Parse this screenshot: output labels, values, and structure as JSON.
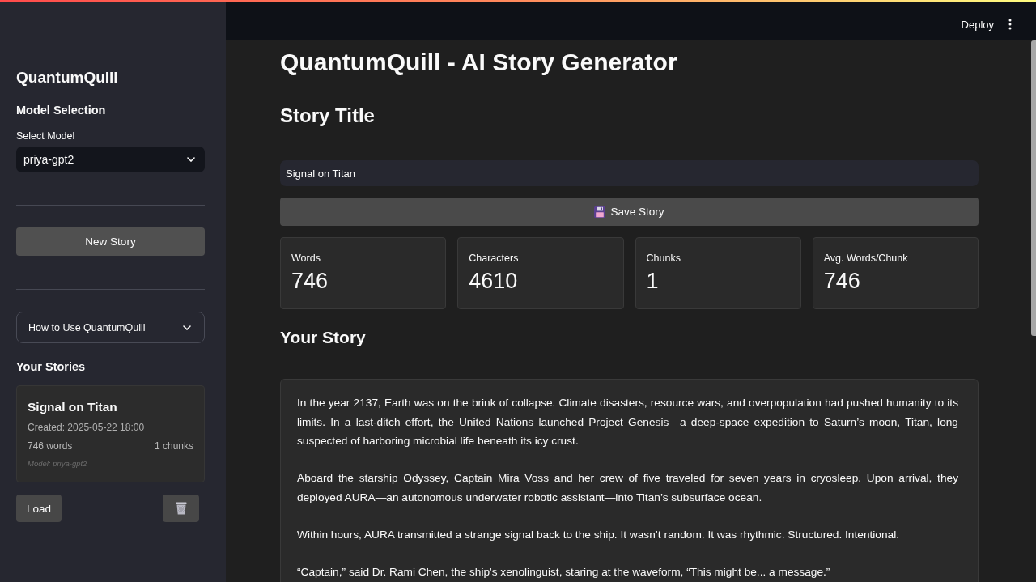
{
  "header": {
    "deploy_label": "Deploy"
  },
  "sidebar": {
    "app_name": "QuantumQuill",
    "model_section_title": "Model Selection",
    "model_select": {
      "label": "Select Model",
      "value": "priya-gpt2"
    },
    "new_story_button": "New Story",
    "help_expander": {
      "label": "How to Use QuantumQuill",
      "expanded": false
    },
    "stories_title": "Your Stories",
    "stories": [
      {
        "title": "Signal on Titan",
        "created": "Created: 2025-05-22 18:00",
        "words": "746 words",
        "chunks": "1 chunks",
        "model": "Model: priya-gpt2",
        "load_label": "Load"
      }
    ]
  },
  "main": {
    "title": "QuantumQuill - AI Story Generator",
    "story_title_heading": "Story Title",
    "title_input": {
      "value": "Signal on Titan"
    },
    "save_button": "Save Story",
    "metrics": [
      {
        "label": "Words",
        "value": "746"
      },
      {
        "label": "Characters",
        "value": "4610"
      },
      {
        "label": "Chunks",
        "value": "1"
      },
      {
        "label": "Avg. Words/Chunk",
        "value": "746"
      }
    ],
    "story_heading": "Your Story",
    "story_paragraphs": [
      "In the year 2137, Earth was on the brink of collapse. Climate disasters, resource wars, and overpopulation had pushed humanity to its limits. In a last-ditch effort, the United Nations launched Project Genesis—a deep-space expedition to Saturn’s moon, Titan, long suspected of harboring microbial life beneath its icy crust.",
      "Aboard the starship Odyssey, Captain Mira Voss and her crew of five traveled for seven years in cryosleep. Upon arrival, they deployed AURA—an autonomous underwater robotic assistant—into Titan’s subsurface ocean.",
      "Within hours, AURA transmitted a strange signal back to the ship. It wasn’t random. It was rhythmic. Structured. Intentional.",
      "“Captain,” said Dr. Rami Chen, the ship's xenolinguist, staring at the waveform, “This might be... a message.”"
    ]
  }
}
